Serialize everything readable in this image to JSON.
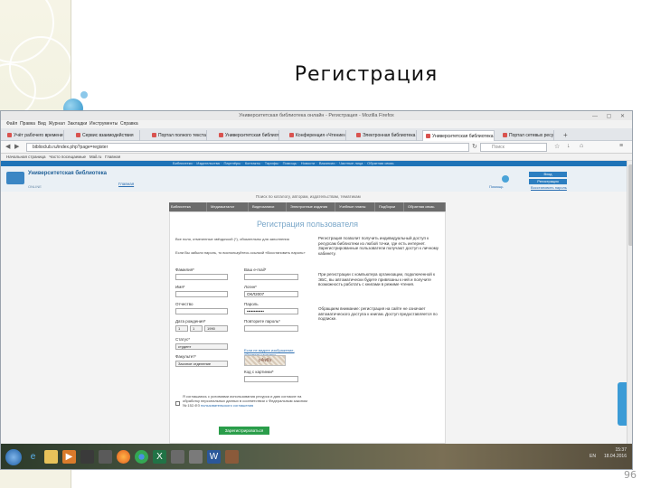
{
  "slide": {
    "title": "Регистрация",
    "page_number": "96"
  },
  "browser": {
    "window_title": "Университетская библиотека онлайн - Регистрация - Mozilla Firefox",
    "menu": [
      "Файл",
      "Правка",
      "Вид",
      "Журнал",
      "Закладки",
      "Инструменты",
      "Справка"
    ],
    "tabs": [
      {
        "label": "Учёт рабочего времени"
      },
      {
        "label": "Сервис взаимодействия"
      },
      {
        "label": "Портал полного текста"
      },
      {
        "label": "Университетская библиотека"
      },
      {
        "label": "Конференция «Чтение»"
      },
      {
        "label": "Электронная библиотека"
      },
      {
        "label": "Университетская библиотека онлайн"
      },
      {
        "label": "Портал сетевых ресурсов"
      }
    ],
    "url": "biblioclub.ru/index.php?page=register",
    "search_placeholder": "Поиск",
    "bookmarks": [
      "Начальная страница",
      "Часто посещаемые",
      "Mail.ru",
      "Главная"
    ]
  },
  "site": {
    "top_links": [
      "Библиотеки",
      "Издательства",
      "Партнёры",
      "Контакты",
      "Тарифы",
      "Помощь",
      "Новости",
      "Вакансии",
      "Частные лица",
      "Обратная связь"
    ],
    "logo_title": "Университетская библиотека",
    "logo_sub": "ONLINE",
    "header_link": "Главная",
    "help_label": "Помощь",
    "login_button": "Вход",
    "register_button": "Регистрация",
    "forgot_link": "Восстановить пароль",
    "search_hint": "Поиск по каталогу, авторам, издательствам, тематикам",
    "section_nav": [
      "Библиотека",
      "Медиакаталог",
      "Видеозаписи",
      "Электронные издания",
      "Учебные планы",
      "Подборки",
      "Обратная связь"
    ],
    "form": {
      "title": "Регистрация пользователя",
      "note1": "Все поля, отмеченные звёздочкой (*), обязательны для заполнения",
      "note2": "Если Вы забыли пароль, то воспользуйтесь ссылкой «Восстановить пароль»",
      "labels": {
        "surname": "Фамилия*",
        "name": "Имя*",
        "patronymic": "Отчество",
        "birthdate": "Дата рождения*",
        "status": "Статус*",
        "faculty": "Факультет*",
        "email": "Ваш e-mail*",
        "login": "Логин*",
        "password": "Пароль",
        "password_confirm": "Повторите пароль*",
        "captcha_hint": "Если не видите изображение, обновите картинку",
        "captcha_input": "Код с картинки*"
      },
      "values": {
        "birth_day": "1",
        "birth_month": "1",
        "birth_year": "1990",
        "status": "студент",
        "faculty": "Заочное отделение",
        "login": "ОКЛ2007",
        "password": "••••••••••••"
      },
      "captcha_text": "c4w8u",
      "consent_text": "Я соглашаюсь с условиями использования ресурса и даю согласие на обработку персональных данных в соответствии с Федеральным законом № 152-ФЗ",
      "consent_link": "пользовательского соглашения",
      "submit_label": "Зарегистрироваться"
    },
    "info": {
      "p1": "Регистрация позволит получить индивидуальный доступ к ресурсам библиотеки из любой точки, где есть интернет. Зарегистрированные пользователи получают доступ к личному кабинету.",
      "p2": "При регистрации с компьютера организации, подключенной к ЭБС, вы автоматически будете привязаны к ней и получите возможность работать с книгами в режиме чтения.",
      "p3": "Обращаем внимание: регистрация на сайте не означает автоматического доступа к книгам. Доступ предоставляется по подписке."
    }
  },
  "taskbar": {
    "time": "15:37",
    "date": "18.04.2016",
    "lang": "EN"
  }
}
